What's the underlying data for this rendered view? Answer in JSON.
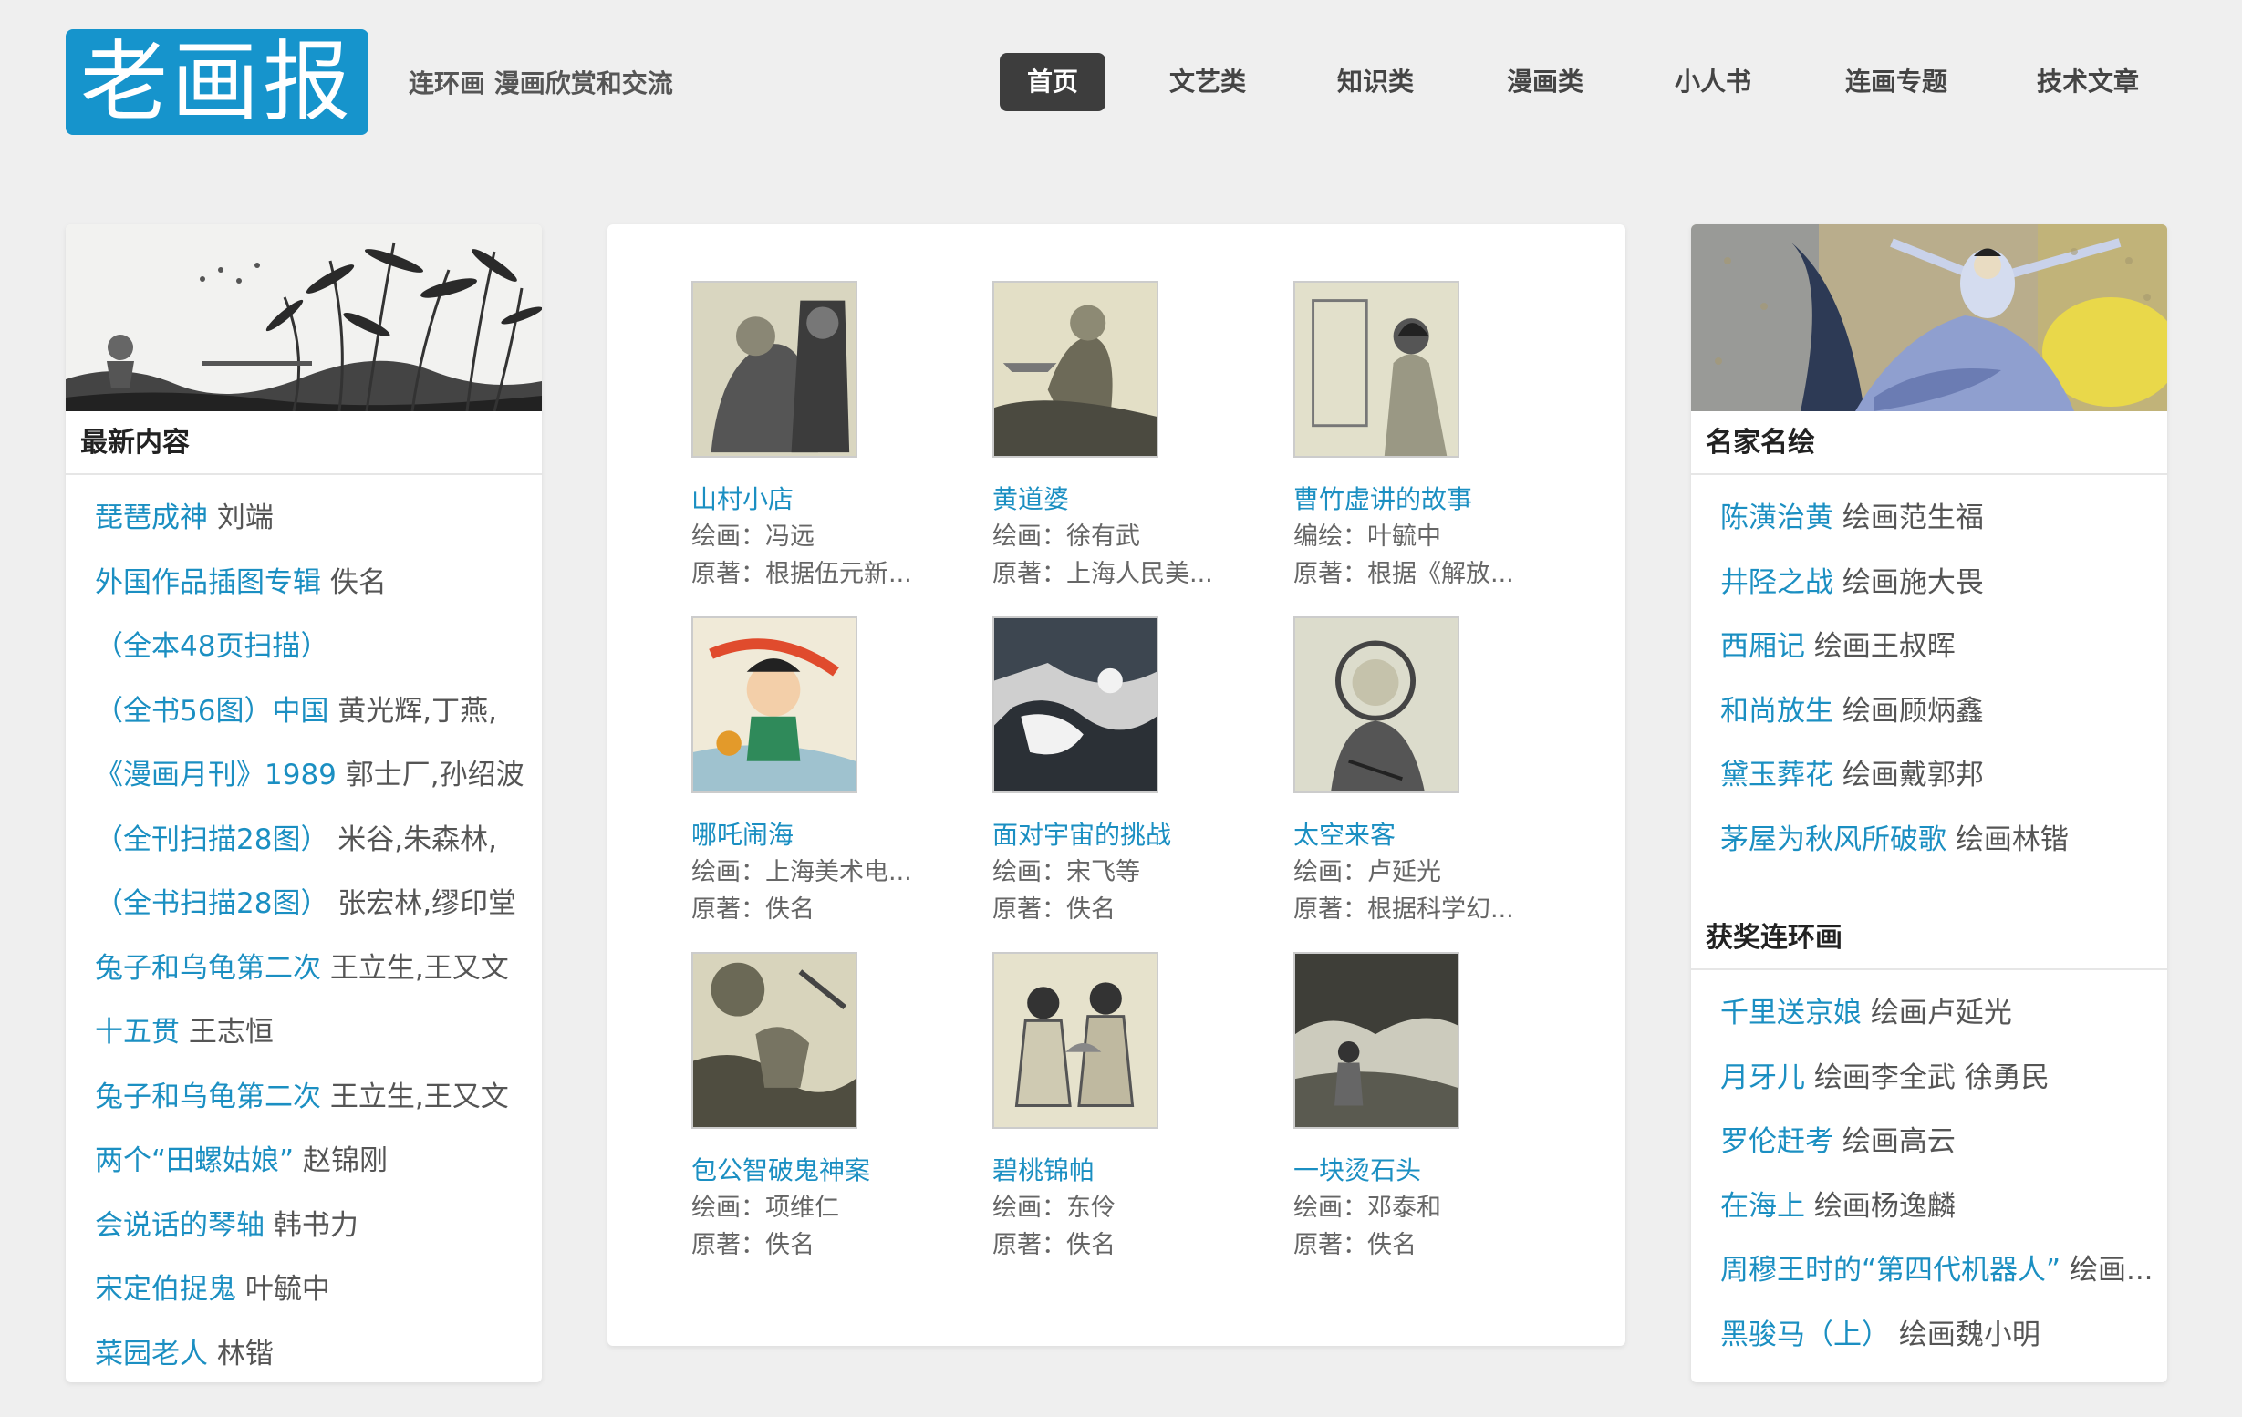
{
  "header": {
    "logo": "老画报",
    "tagline": "连环画 漫画欣赏和交流",
    "nav": [
      "首页",
      "文艺类",
      "知识类",
      "漫画类",
      "小人书",
      "连画专题",
      "技术文章"
    ],
    "active_nav": "首页"
  },
  "left": {
    "title": "最新内容",
    "items": [
      {
        "t": "琵琶成神",
        "a": " 刘端"
      },
      {
        "t": "外国作品插图专辑",
        "a": " 佚名"
      },
      {
        "t": "（全本48页扫描）",
        "a": ""
      },
      {
        "t": "（全书56图）中国",
        "a": " 黄光辉,丁燕,"
      },
      {
        "t": "《漫画月刊》1989",
        "a": " 郭士厂,孙绍波"
      },
      {
        "t": "（全刊扫描28图）",
        "a": " 米谷,朱森林,"
      },
      {
        "t": "（全书扫描28图）",
        "a": " 张宏林,缪印堂"
      },
      {
        "t": "兔子和乌龟第二次",
        "a": " 王立生,王又文"
      },
      {
        "t": "十五贯",
        "a": " 王志恒"
      },
      {
        "t": "兔子和乌龟第二次",
        "a": " 王立生,王又文"
      },
      {
        "t": "两个“田螺姑娘”",
        "a": " 赵锦刚"
      },
      {
        "t": "会说话的琴轴",
        "a": " 韩书力"
      },
      {
        "t": "宋定伯捉鬼",
        "a": " 叶毓中"
      },
      {
        "t": "菜园老人",
        "a": " 林锴"
      }
    ]
  },
  "center": {
    "cards": [
      {
        "title": "山村小店",
        "l1": "绘画：冯远",
        "l2": "原著：根据伍元新..."
      },
      {
        "title": "黄道婆",
        "l1": "绘画：徐有武",
        "l2": "原著：上海人民美..."
      },
      {
        "title": "曹竹虚讲的故事",
        "l1": "编绘：叶毓中",
        "l2": "原著：根据《解放..."
      },
      {
        "title": "哪吒闹海",
        "l1": "绘画：上海美术电...",
        "l2": "原著：佚名"
      },
      {
        "title": "面对宇宙的挑战",
        "l1": "绘画：宋飞等",
        "l2": "原著：佚名"
      },
      {
        "title": "太空来客",
        "l1": "绘画：卢延光",
        "l2": "原著：根据科学幻..."
      },
      {
        "title": "包公智破鬼神案",
        "l1": "绘画：项维仁",
        "l2": "原著：佚名"
      },
      {
        "title": "碧桃锦帕",
        "l1": "绘画：东伶",
        "l2": "原著：佚名"
      },
      {
        "title": "一块烫石头",
        "l1": "绘画：邓泰和",
        "l2": "原著：佚名"
      }
    ]
  },
  "right": {
    "title1": "名家名绘",
    "items1": [
      {
        "t": "陈潢治黄",
        "a": " 绘画范生福"
      },
      {
        "t": "井陉之战",
        "a": " 绘画施大畏"
      },
      {
        "t": "西厢记",
        "a": " 绘画王叔晖"
      },
      {
        "t": "和尚放生",
        "a": " 绘画顾炳鑫"
      },
      {
        "t": "黛玉葬花",
        "a": " 绘画戴郭邦"
      },
      {
        "t": "茅屋为秋风所破歌",
        "a": " 绘画林锴"
      }
    ],
    "title2": "获奖连环画",
    "items2": [
      {
        "t": "千里送京娘",
        "a": " 绘画卢延光"
      },
      {
        "t": "月牙儿",
        "a": " 绘画李全武 徐勇民"
      },
      {
        "t": "罗伦赶考",
        "a": " 绘画高云"
      },
      {
        "t": "在海上",
        "a": " 绘画杨逸麟"
      },
      {
        "t": "周穆王时的“第四代机器人”",
        "a": " 绘画..."
      },
      {
        "t": "黑骏马（上）",
        "a": " 绘画魏小明"
      }
    ]
  },
  "colors": {
    "accent": "#1694cc",
    "link": "#1b8fc2",
    "nav_active": "#3d3d3d"
  }
}
